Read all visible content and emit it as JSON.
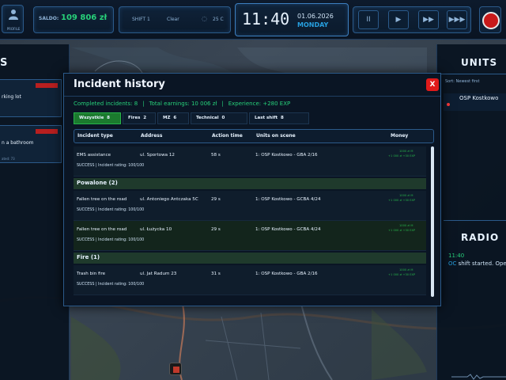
{
  "topbar": {
    "profile_label": "PROFILE",
    "saldo_label": "SALDO:",
    "saldo_value": "109 806 zł",
    "shift_label": "SHIFT 1",
    "weather": "Clear",
    "temperature": "25 C",
    "time": "11:40",
    "date": "01.06.2026",
    "weekday": "MONDAY",
    "speed_buttons": [
      "II",
      "▶",
      "▶▶",
      "▶▶▶"
    ]
  },
  "left_panel": {
    "header": "S",
    "cards": [
      {
        "text": "rking lot",
        "sub": ""
      },
      {
        "text": "n a bathroom",
        "sub": "ated: 73"
      }
    ]
  },
  "right_panel": {
    "units_title": "UNITS",
    "sort_label": "Sort:",
    "sort_value": "Newest first",
    "unit_name": "OSP Kostkowo",
    "radio_title": "RADIO",
    "radio_time": "11:40",
    "radio_sender": "OC",
    "radio_message": "shift started. Ope"
  },
  "modal": {
    "title": "Incident history",
    "close_label": "X",
    "stats": {
      "completed": "Completed incidents: 8",
      "earnings": "Total earnings: 10 006 zł",
      "experience": "Experience: +280 EXP"
    },
    "tabs": [
      {
        "label": "Wszystkie",
        "count": "8",
        "active": true
      },
      {
        "label": "Fires",
        "count": "2",
        "active": false
      },
      {
        "label": "MZ",
        "count": "6",
        "active": false
      },
      {
        "label": "Technical",
        "count": "0",
        "active": false
      },
      {
        "label": "Last shift",
        "count": "8",
        "active": false
      }
    ],
    "columns": [
      "Incident type",
      "Address",
      "Action time",
      "Units on scene",
      "Money"
    ],
    "groups": [
      {
        "title": "",
        "rows": [
          {
            "type": "EMS assistance",
            "address": "ul. Sportowa 12",
            "time": "58 s",
            "units": "1: OSP Kostkowo - GBA 2/16",
            "result": "SUCCESS | Incident rating: 100/100",
            "money1": "1000 zł  M",
            "money2": "+1 000 zł  +30 EXP",
            "green": false
          }
        ]
      },
      {
        "title": "Powalone (2)",
        "rows": [
          {
            "type": "Fallen tree on the road",
            "address": "ul. Antoniego Antczaka 5C",
            "time": "29 s",
            "units": "1: OSP Kostkowo - GCBA 4/24",
            "result": "SUCCESS | Incident rating: 100/100",
            "money1": "1000 zł  M",
            "money2": "+1 000 zł  +30 EXP",
            "green": false
          },
          {
            "type": "Fallen tree on the road",
            "address": "ul. Łużycka 10",
            "time": "29 s",
            "units": "1: OSP Kostkowo - GCBA 4/24",
            "result": "SUCCESS | Incident rating: 100/100",
            "money1": "1000 zł  M",
            "money2": "+1 000 zł  +30 EXP",
            "green": true
          }
        ]
      },
      {
        "title": "Fire (1)",
        "rows": [
          {
            "type": "Trash bin fire",
            "address": "ul. Jat Radum 23",
            "time": "31 s",
            "units": "1: OSP Kostkowo - GBA 2/16",
            "result": "SUCCESS | Incident rating: 100/100",
            "money1": "1000 zł  M",
            "money2": "+1 000 zł  +30 EXP",
            "green": false
          }
        ]
      }
    ]
  }
}
